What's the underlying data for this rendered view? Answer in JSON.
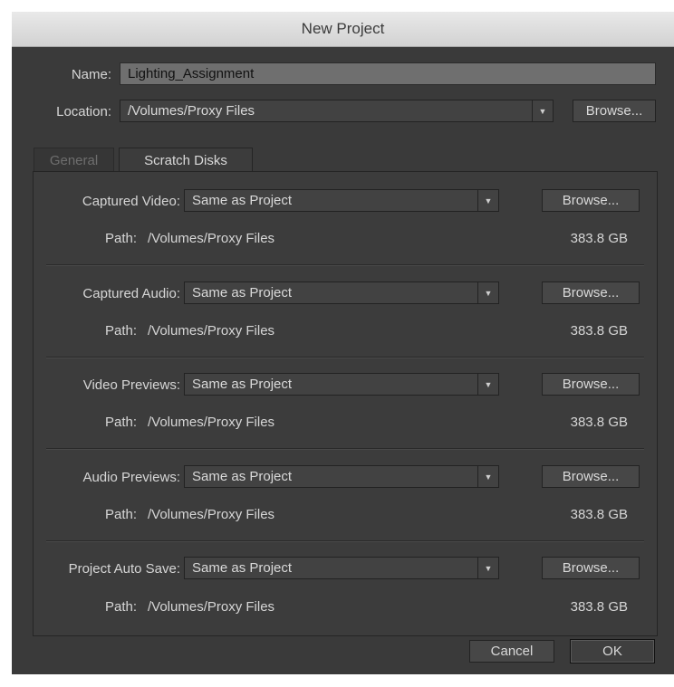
{
  "window": {
    "title": "New Project"
  },
  "name_row": {
    "label": "Name:",
    "value": "Lighting_Assignment"
  },
  "location_row": {
    "label": "Location:",
    "value": "/Volumes/Proxy Files",
    "browse": "Browse..."
  },
  "tabs": [
    {
      "label": "General",
      "active": false
    },
    {
      "label": "Scratch Disks",
      "active": true
    }
  ],
  "scratch_disks": [
    {
      "label": "Captured Video:",
      "value": "Same as Project",
      "browse": "Browse...",
      "path_label": "Path:",
      "path": "/Volumes/Proxy Files",
      "size": "383.8 GB"
    },
    {
      "label": "Captured Audio:",
      "value": "Same as Project",
      "browse": "Browse...",
      "path_label": "Path:",
      "path": "/Volumes/Proxy Files",
      "size": "383.8 GB"
    },
    {
      "label": "Video Previews:",
      "value": "Same as Project",
      "browse": "Browse...",
      "path_label": "Path:",
      "path": "/Volumes/Proxy Files",
      "size": "383.8 GB"
    },
    {
      "label": "Audio Previews:",
      "value": "Same as Project",
      "browse": "Browse...",
      "path_label": "Path:",
      "path": "/Volumes/Proxy Files",
      "size": "383.8 GB"
    },
    {
      "label": "Project Auto Save:",
      "value": "Same as Project",
      "browse": "Browse...",
      "path_label": "Path:",
      "path": "/Volumes/Proxy Files",
      "size": "383.8 GB"
    }
  ],
  "footer": {
    "cancel": "Cancel",
    "ok": "OK"
  }
}
